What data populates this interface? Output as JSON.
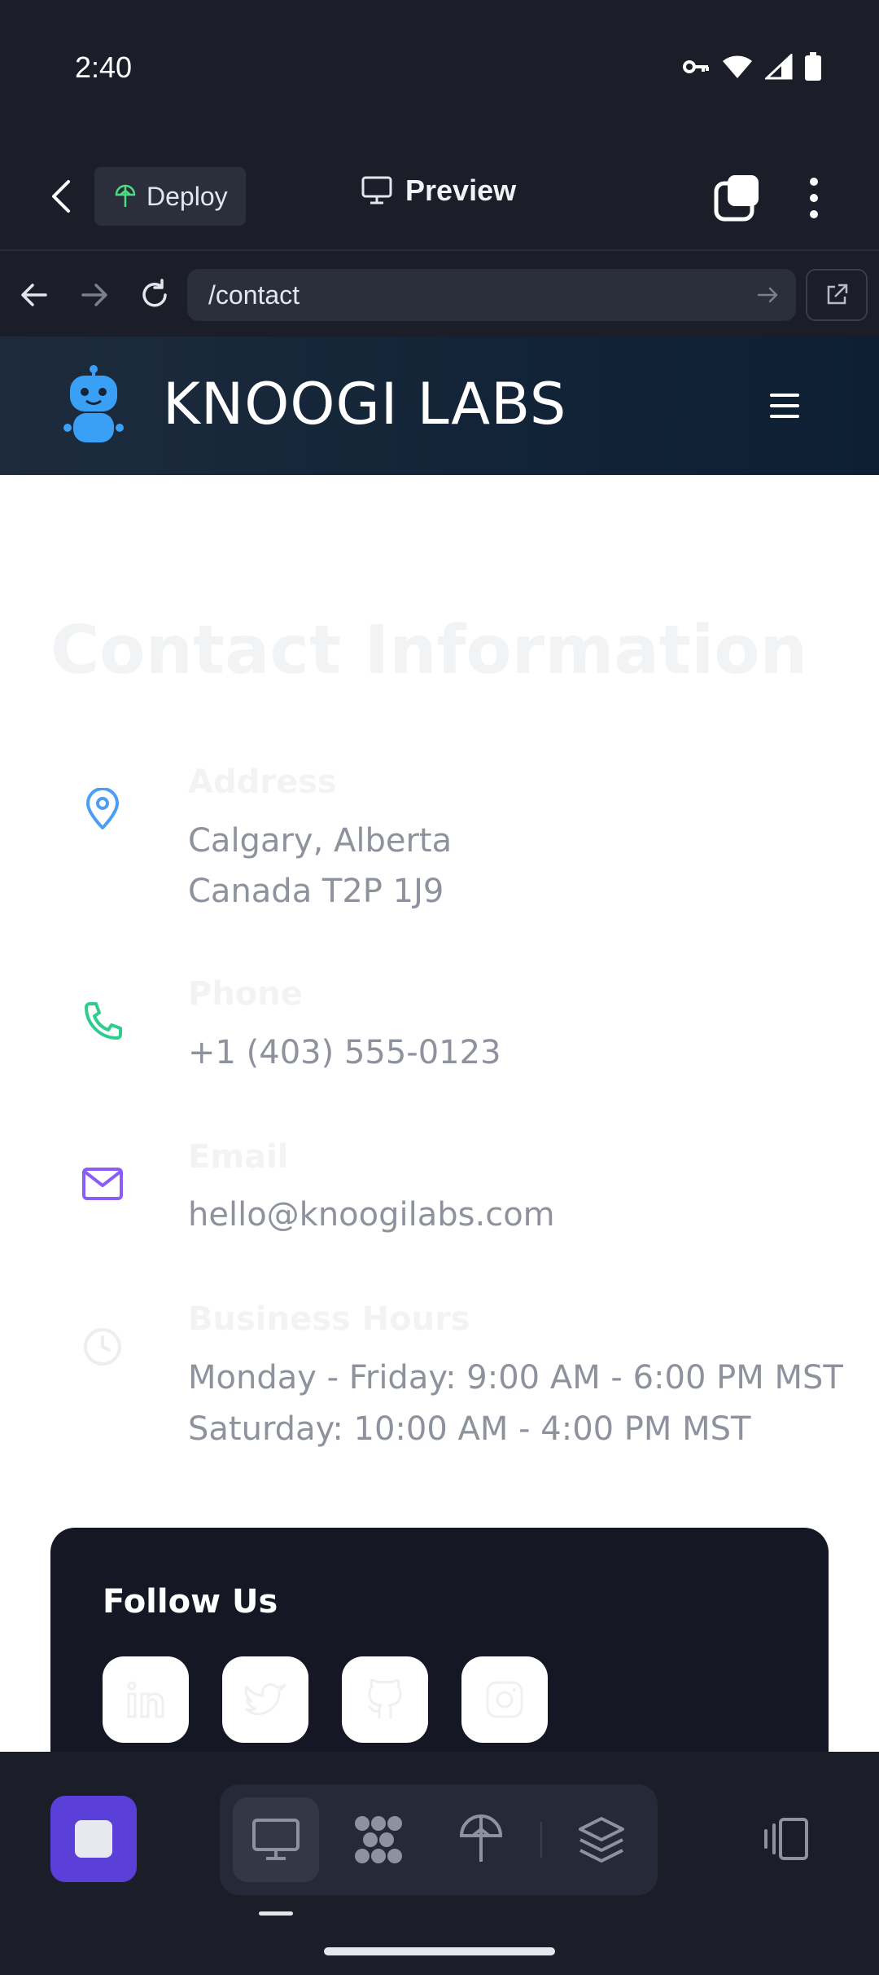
{
  "status_bar": {
    "time": "2:40",
    "icons": [
      "key-icon",
      "wifi-icon",
      "signal-icon",
      "battery-icon"
    ]
  },
  "toolbar": {
    "deploy_label": "Deploy",
    "preview_label": "Preview"
  },
  "browser": {
    "url": "/contact"
  },
  "site": {
    "name": "KNOOGI LABS",
    "heading": "Contact Information",
    "address": {
      "label": "Address",
      "line1": "Calgary, Alberta",
      "line2": "Canada T2P 1J9"
    },
    "phone": {
      "label": "Phone",
      "value": "+1 (403) 555-0123"
    },
    "email": {
      "label": "Email",
      "value": "hello@knoogilabs.com"
    },
    "hours": {
      "label": "Business Hours",
      "line1": "Monday - Friday: 9:00 AM - 6:00 PM MST",
      "line2": "Saturday: 10:00 AM - 4:00 PM MST"
    },
    "follow": {
      "title": "Follow Us",
      "socials": [
        "linkedin-icon",
        "twitter-icon",
        "github-icon",
        "instagram-icon"
      ]
    }
  },
  "colors": {
    "accent_purple": "#5a3fd9",
    "location_blue": "#4a9ff5",
    "phone_green": "#2ecc8f",
    "email_purple": "#8b5cf6",
    "header_navy": "#132438"
  }
}
